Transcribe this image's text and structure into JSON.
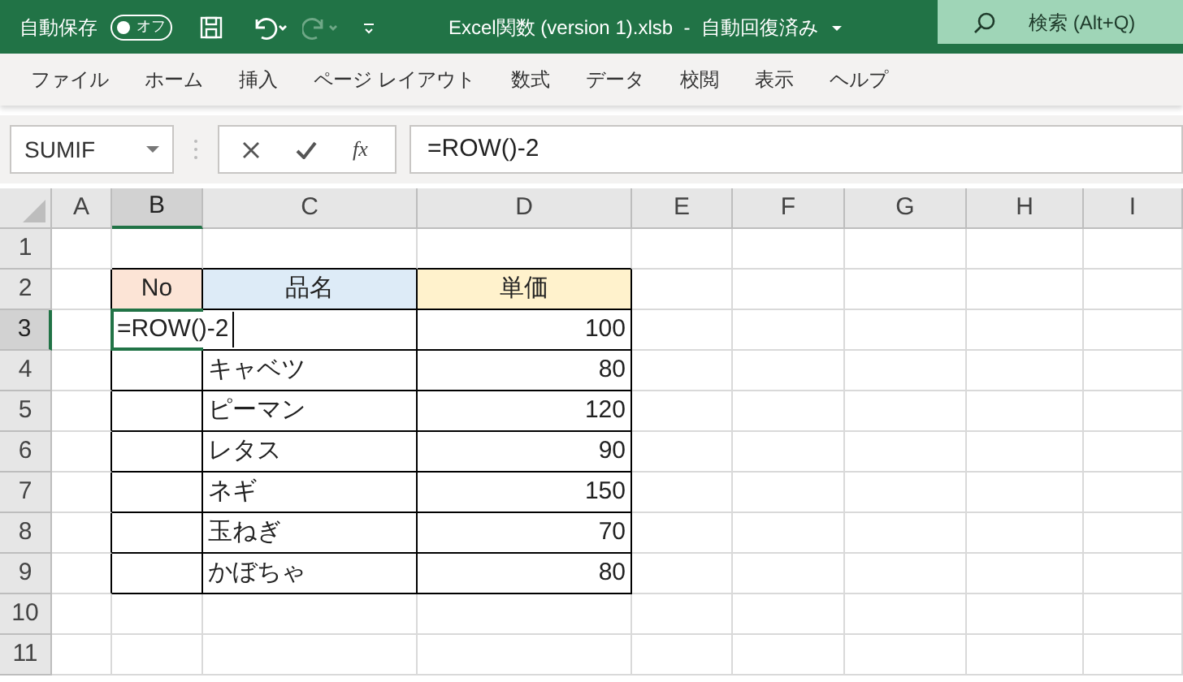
{
  "title_bar": {
    "autosave_label": "自動保存",
    "autosave_toggle": {
      "label": "オフ",
      "on": false
    },
    "title": "Excel関数 (version 1).xlsb  -  自動回復済み",
    "search_placeholder": "検索 (Alt+Q)"
  },
  "ribbon_tabs": [
    {
      "label": "ファイル",
      "selected": false
    },
    {
      "label": "ホーム",
      "selected": false
    },
    {
      "label": "挿入",
      "selected": false
    },
    {
      "label": "ページ レイアウト",
      "selected": false
    },
    {
      "label": "数式",
      "selected": false
    },
    {
      "label": "データ",
      "selected": false
    },
    {
      "label": "校閲",
      "selected": false
    },
    {
      "label": "表示",
      "selected": false
    },
    {
      "label": "ヘルプ",
      "selected": false
    }
  ],
  "formula_bar": {
    "name_box": "SUMIF",
    "fx_label": "fx",
    "formula": "=ROW()-2"
  },
  "sheet": {
    "columns": [
      {
        "label": "A",
        "selected": false
      },
      {
        "label": "B",
        "selected": true
      },
      {
        "label": "C",
        "selected": false
      },
      {
        "label": "D",
        "selected": false
      },
      {
        "label": "E",
        "selected": false
      },
      {
        "label": "F",
        "selected": false
      },
      {
        "label": "G",
        "selected": false
      },
      {
        "label": "H",
        "selected": false
      },
      {
        "label": "I",
        "selected": false
      }
    ],
    "rows": [
      {
        "label": "1",
        "selected": false
      },
      {
        "label": "2",
        "selected": false
      },
      {
        "label": "3",
        "selected": true
      },
      {
        "label": "4",
        "selected": false
      },
      {
        "label": "5",
        "selected": false
      },
      {
        "label": "6",
        "selected": false
      },
      {
        "label": "7",
        "selected": false
      },
      {
        "label": "8",
        "selected": false
      },
      {
        "label": "9",
        "selected": false
      },
      {
        "label": "10",
        "selected": false
      },
      {
        "label": "11",
        "selected": false
      }
    ],
    "table": {
      "header": [
        {
          "text": "No",
          "color": "#fce4d6"
        },
        {
          "text": "品名",
          "color": "#ddebf7"
        },
        {
          "text": "単価",
          "color": "#fff2cc"
        }
      ],
      "rows": [
        {
          "editing": "=ROW()-2",
          "price": "100"
        },
        {
          "name": "キャベツ",
          "price": "80"
        },
        {
          "name": "ピーマン",
          "price": "120"
        },
        {
          "name": "レタス",
          "price": "90"
        },
        {
          "name": "ネギ",
          "price": "150"
        },
        {
          "name": "玉ねぎ",
          "price": "70"
        },
        {
          "name": "かぼちゃ",
          "price": "80"
        }
      ]
    }
  }
}
